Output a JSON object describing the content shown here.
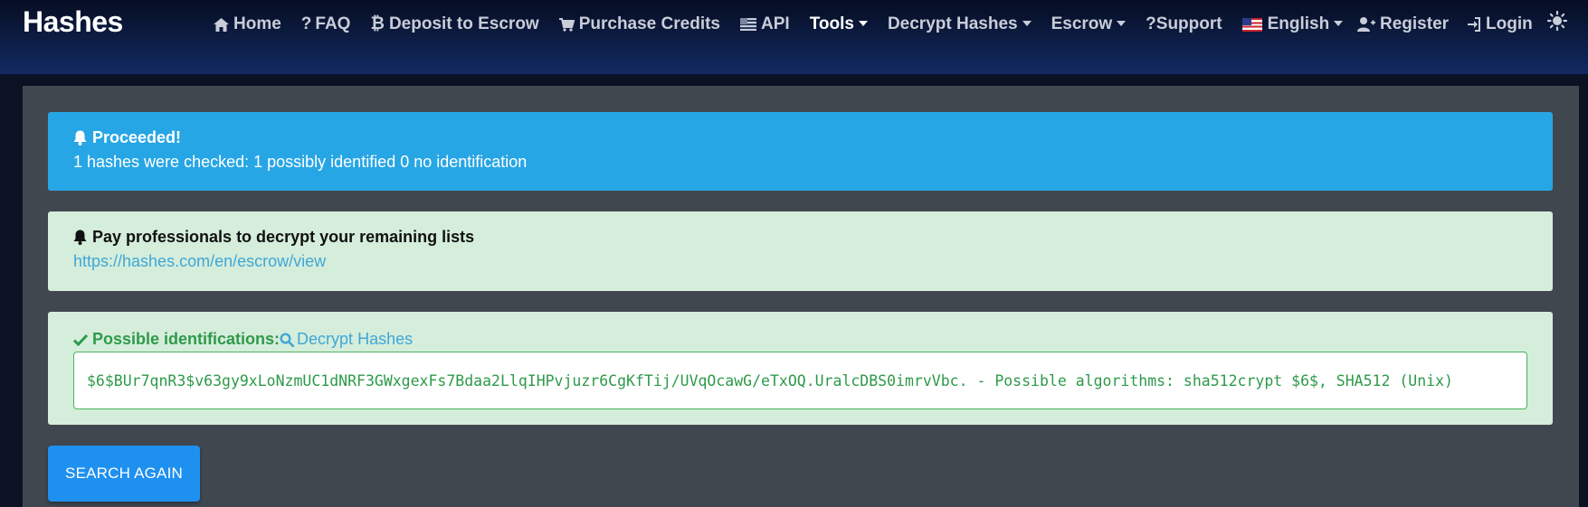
{
  "brand": "Hashes",
  "nav": {
    "home": "Home",
    "faq": "FAQ",
    "deposit": "Deposit to Escrow",
    "purchase": "Purchase Credits",
    "api": "API",
    "tools": "Tools",
    "decrypt": "Decrypt Hashes",
    "escrow": "Escrow",
    "support": "Support",
    "language": "English",
    "register": "Register",
    "login": "Login"
  },
  "alerts": {
    "info": {
      "title": "Proceeded!",
      "text": "1 hashes were checked: 1 possibly identified 0 no identification"
    },
    "promo": {
      "title": "Pay professionals to decrypt your remaining lists",
      "link": "https://hashes.com/en/escrow/view"
    },
    "result": {
      "label": "Possible identifications:",
      "link": "Decrypt Hashes",
      "value": "$6$BUr7qnR3$v63gy9xLoNzmUC1dNRF3GWxgexFs7Bdaa2LlqIHPvjuzr6CgKfTij/UVqOcawG/eTxOQ.UralcDBS0imrvVbc. - Possible algorithms: sha512crypt $6$, SHA512 (Unix)"
    }
  },
  "button": {
    "search_again": "SEARCH AGAIN"
  },
  "colors": {
    "info": "#27a6e5",
    "success_bg": "#d5eddb",
    "success_text": "#2e9a4a",
    "link": "#3fa7d6",
    "panel": "#41474f",
    "button": "#1e90f0"
  }
}
